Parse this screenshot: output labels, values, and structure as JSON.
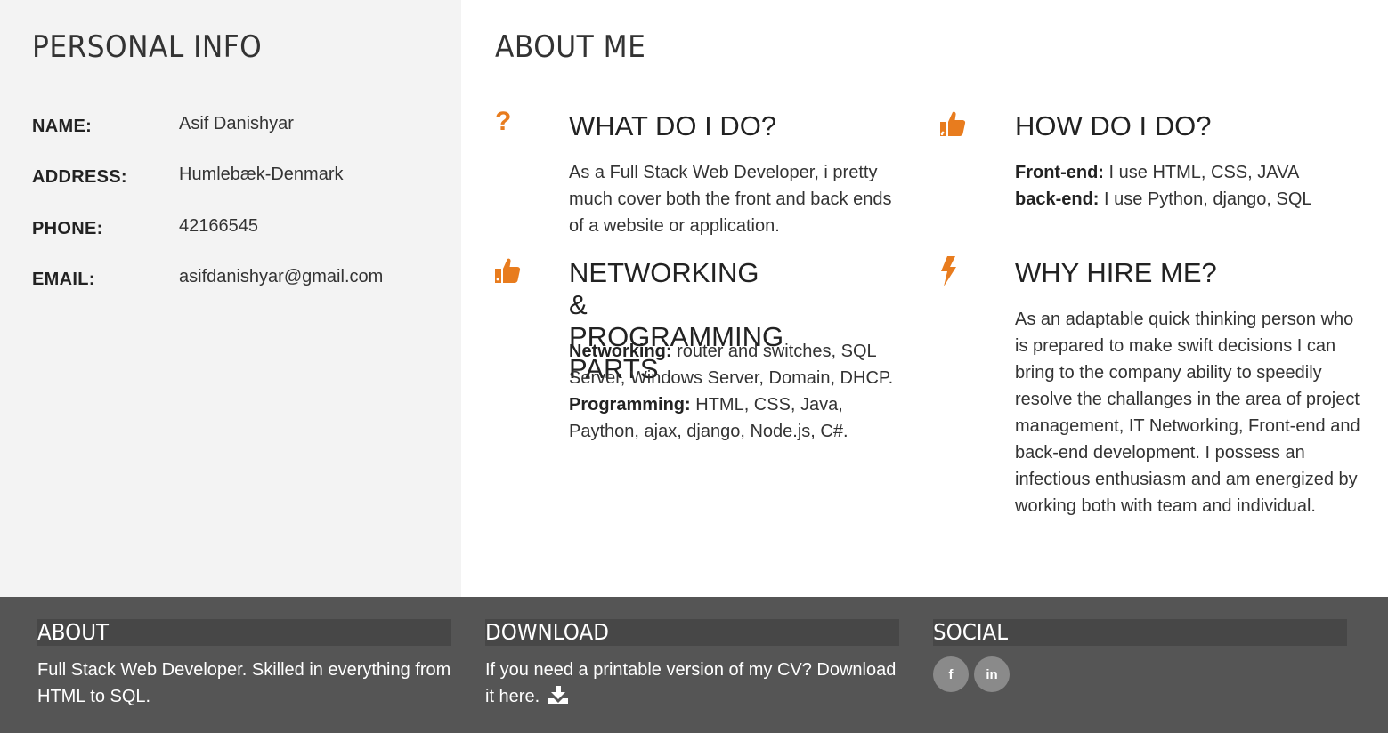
{
  "colors": {
    "accent": "#e87c1e",
    "footer_bg": "#555555",
    "footer_head_bg": "#474747",
    "personal_bg": "#f3f3f3"
  },
  "personal": {
    "title": "PERSONAL INFO",
    "rows": [
      {
        "label": "NAME:",
        "value": "Asif Danishyar"
      },
      {
        "label": "ADDRESS:",
        "value": "Humlebæk-Denmark"
      },
      {
        "label": "PHONE:",
        "value": "42166545"
      },
      {
        "label": "EMAIL:",
        "value": "asifdanishyar@gmail.com"
      }
    ]
  },
  "about": {
    "title": "ABOUT ME",
    "what": {
      "icon": "question-mark-icon",
      "title": "WHAT DO I DO?",
      "text": "As a Full Stack Web Developer, i pretty much cover both the front and back ends of a website or application."
    },
    "how": {
      "icon": "thumbs-up-icon",
      "title": "HOW DO I DO?",
      "frontend_label": "Front-end:",
      "frontend_text": " I use HTML, CSS, JAVA",
      "backend_label": "back-end:",
      "backend_text": " I use Python, django, SQL"
    },
    "networking": {
      "icon": "thumbs-up-icon",
      "title_line1": "NETWORKING &",
      "title_line2": "PROGRAMMING PARTS",
      "networking_label": "Networking:",
      "networking_text": " router and switches, SQL Server, Windows Server, Domain, DHCP.",
      "programming_label": "Programming:",
      "programming_text": " HTML, CSS, Java, Paython, ajax, django, Node.js, C#."
    },
    "why": {
      "icon": "lightning-bolt-icon",
      "title": "WHY HIRE ME?",
      "text": "As an adaptable quick thinking person who is prepared to make swift decisions I can bring to the company ability to speedily resolve the challanges in the area of project management, IT Networking, Front-end and back-end development. I possess an infectious enthusiasm and am energized by working both with team and individual."
    }
  },
  "footer": {
    "about": {
      "title": "ABOUT",
      "text": "Full Stack Web Developer. Skilled in everything from HTML to SQL."
    },
    "download": {
      "title": "DOWNLOAD",
      "text": "If you need a printable version of my CV? Download it here.",
      "icon": "download-icon"
    },
    "social": {
      "title": "SOCIAL",
      "facebook": "f",
      "linkedin": "in"
    }
  }
}
